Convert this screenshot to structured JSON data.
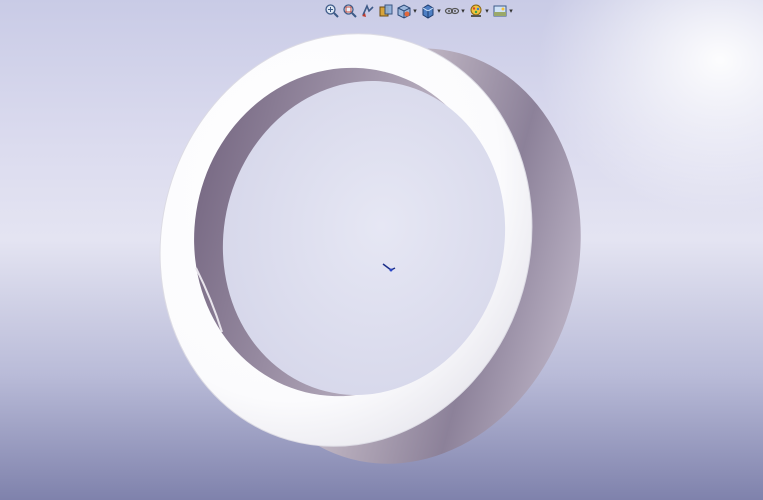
{
  "window": {
    "view": "solidworks-graphics-area"
  },
  "toolbar": {
    "items": [
      {
        "icon": "zoom-to-fit-icon",
        "dropdown": false
      },
      {
        "icon": "zoom-to-area-icon",
        "dropdown": false
      },
      {
        "icon": "previous-view-icon",
        "dropdown": false
      },
      {
        "icon": "section-view-icon",
        "dropdown": false
      },
      {
        "icon": "view-orientation-icon",
        "dropdown": true
      },
      {
        "icon": "display-style-icon",
        "dropdown": true
      },
      {
        "icon": "hide-show-items-icon",
        "dropdown": true
      },
      {
        "icon": "edit-appearance-icon",
        "dropdown": true
      },
      {
        "icon": "apply-scene-icon",
        "dropdown": true
      }
    ]
  },
  "model": {
    "shape": "ring",
    "color": "#ffffff",
    "inner_color": "#8b8199"
  },
  "colors": {
    "bg_top": "#c9cbe6",
    "bg_bottom": "#7f82ac"
  }
}
